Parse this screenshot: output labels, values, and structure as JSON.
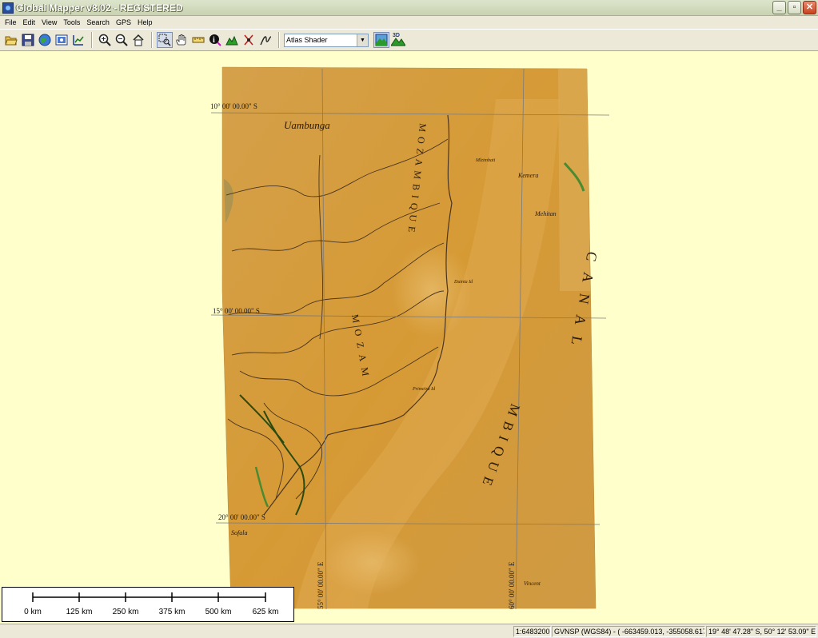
{
  "window": {
    "title": "Global Mapper v8.02 - REGISTERED",
    "controls": [
      "_",
      "▫",
      "✕"
    ]
  },
  "menu": [
    "File",
    "Edit",
    "View",
    "Tools",
    "Search",
    "GPS",
    "Help"
  ],
  "toolbar": {
    "group1": [
      "open-icon",
      "save-icon",
      "globe-icon",
      "overlay-control-icon",
      "config-icon"
    ],
    "group2": [
      "zoom-in-icon",
      "zoom-out-icon",
      "home-icon"
    ],
    "group3": [
      "zoom-tool-icon",
      "pan-tool-icon",
      "measure-tool-icon",
      "info-tool-icon",
      "path-profile-icon",
      "digitizer-icon",
      "draw-icon"
    ],
    "shader": "Atlas Shader",
    "group4": [
      "shader-toggle-icon",
      "3d-view-icon"
    ],
    "view3d_label": "3D"
  },
  "map": {
    "grid_labels": {
      "lat_10": "10° 00' 00.00\" S",
      "lat_15": "15° 00' 00.00\" S",
      "lat_20": "20° 00' 00.00\" S",
      "lon_55": "55° 00' 00.00\" E",
      "lon_60": "60° 00' 00.00\" E"
    },
    "place_labels": {
      "uambunga": "Uambunga",
      "mozambique_coast": "MOZAMBIQUE",
      "mozambique_land": "MOZAM",
      "canal": "CANAL",
      "mbique": "MBIQUE",
      "sofala": "Sofala",
      "mehitan": "Mehitan",
      "kemera": "Kemera",
      "mlzimbati": "Mlzimbati",
      "primeira": "Primeira Id",
      "duinia": "Duinia Id",
      "vincent": "Vincent"
    },
    "colors": {
      "map_base": "#d19a3c",
      "map_light": "#e3b05a",
      "background": "#ffffcc",
      "grid": "#7a7a7a"
    }
  },
  "scale_bar": {
    "labels": [
      "0 km",
      "125 km",
      "250 km",
      "375 km",
      "500 km",
      "625 km"
    ]
  },
  "status": {
    "scale": "1:6483200",
    "projection": "GVNSP (WGS84) - ( -663459.013, -355058.617 )",
    "coords": "19° 48' 47.28\" S, 50° 12' 53.09\" E"
  }
}
